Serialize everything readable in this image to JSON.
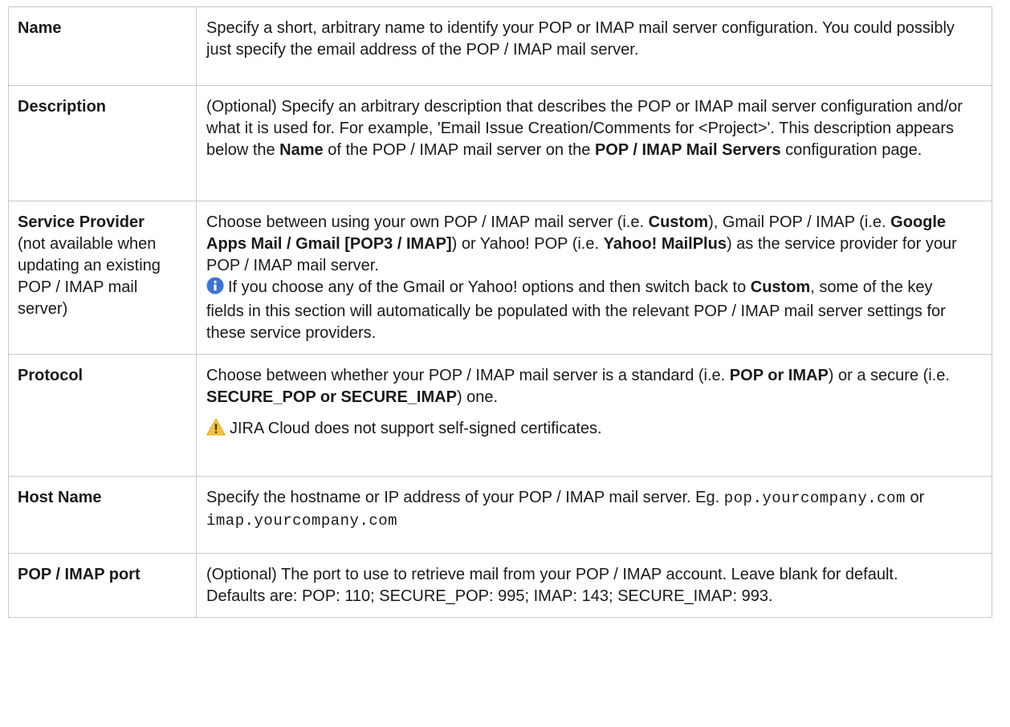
{
  "rows": [
    {
      "field": "Name",
      "text": "Specify a short, arbitrary name to identify your POP or IMAP mail server configuration. You could possibly just specify the email address of the POP / IMAP mail server."
    },
    {
      "field": "Description",
      "p1": "(Optional) Specify an arbitrary description that describes the POP or IMAP mail server configuration and/or what it is used for. For example, 'Email Issue Creation/Comments for <Project>'. This description appears below the ",
      "b1": "Name",
      "p2": " of the POP / IMAP mail server on the ",
      "b2": "POP / IMAP Mail Servers",
      "p3": " configuration page."
    },
    {
      "field": "Service Provider",
      "field_note": "(not available when updating an existing POP / IMAP mail server)",
      "p1": "Choose between using your own POP / IMAP mail server (i.e. ",
      "b1": "Custom",
      "p2": "), Gmail POP / IMAP (i.e. ",
      "b2": "Google Apps Mail / Gmail [POP3 / IMAP]",
      "p3": ") or Yahoo! POP (i.e. ",
      "b3": "Yahoo! MailPlus",
      "p4": ") as the service provider for your POP / IMAP mail server.",
      "info_icon": "info-icon",
      "n1": "If you choose any of the Gmail or Yahoo! options and then switch back to ",
      "nb1": "Custom",
      "n2": ", some of the key fields in this section will automatically be populated with the relevant POP / IMAP mail server settings for these service providers."
    },
    {
      "field": "Protocol",
      "p1": "Choose between whether your POP / IMAP mail server is a standard (i.e. ",
      "b1": "POP or IMAP",
      "p2": ") or a secure (i.e. ",
      "b2": "SECURE_POP or SECURE_IMAP",
      "p3": ") one.",
      "warning_icon": "warning-icon",
      "warning": "JIRA Cloud does not support self-signed certificates."
    },
    {
      "field": "Host Name",
      "p1": "Specify the hostname or IP address of your POP / IMAP mail server. Eg. ",
      "code1": "pop.yourcompany.com",
      "p2": " or ",
      "code2": "imap.yourcompany.com"
    },
    {
      "field": "POP / IMAP port",
      "p1": "(Optional) The port to use to retrieve mail from your POP / IMAP account. Leave blank for default.",
      "p2": "Defaults are: POP: 110; SECURE_POP: 995; IMAP: 143; SECURE_IMAP: 993."
    }
  ],
  "colors": {
    "info": "#3b73d9",
    "warning": "#f6c342",
    "border": "#c8c8c8"
  }
}
